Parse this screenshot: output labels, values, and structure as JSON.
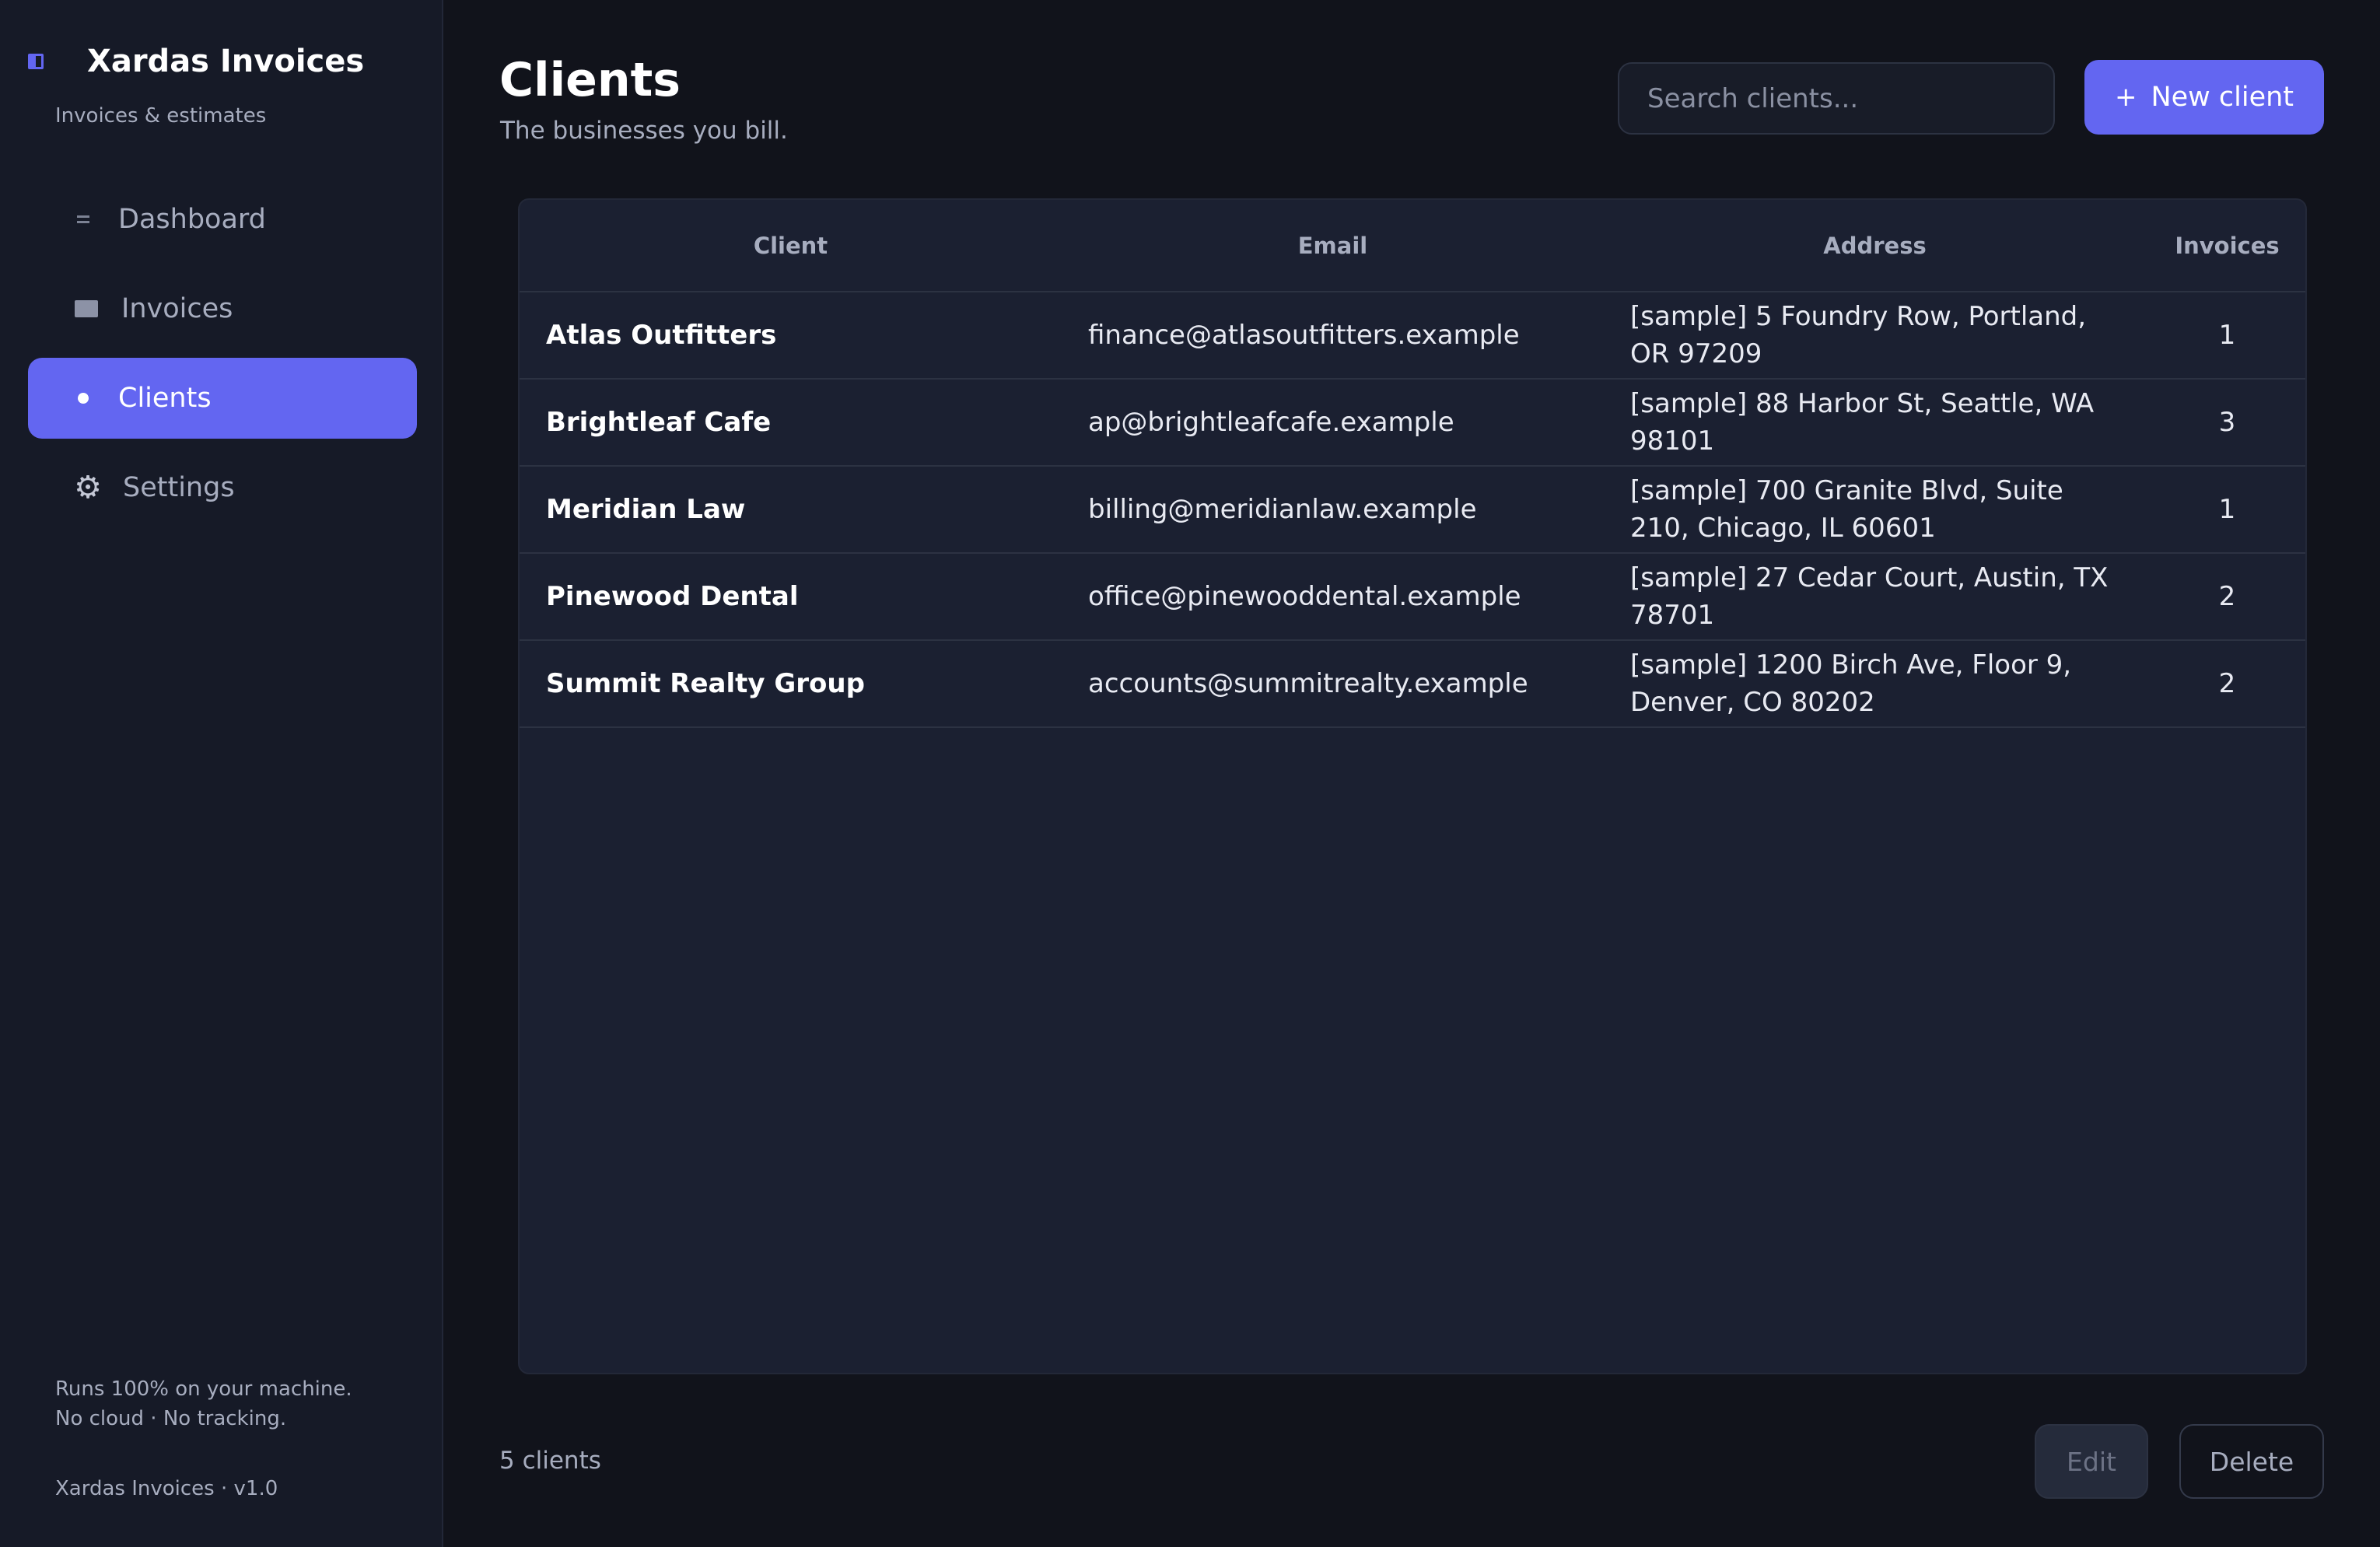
{
  "app": {
    "title": "Xardas Invoices",
    "subtitle": "Invoices & estimates",
    "brand_icon": "sidebar-panel-icon",
    "accent_color": "#6366f1"
  },
  "nav": [
    {
      "label": "Dashboard",
      "icon": "dashboard-icon",
      "active": false
    },
    {
      "label": "Invoices",
      "icon": "invoice-icon",
      "active": false
    },
    {
      "label": "Clients",
      "icon": "dot-icon",
      "active": true
    },
    {
      "label": "Settings",
      "icon": "gear-icon",
      "active": false
    }
  ],
  "sidebar_footer": {
    "line1": "Runs 100% on your machine.",
    "line2": "No cloud · No tracking.",
    "version": "Xardas Invoices · v1.0"
  },
  "page": {
    "title": "Clients",
    "subtitle": "The businesses you bill."
  },
  "search": {
    "placeholder": "Search clients...",
    "value": ""
  },
  "new_client_button": {
    "icon": "+",
    "label": "New client"
  },
  "table": {
    "columns": [
      "Client",
      "Email",
      "Address",
      "Invoices"
    ],
    "rows": [
      {
        "client": "Atlas Outfitters",
        "email": "finance@atlasoutfitters.example",
        "address": "[sample] 5 Foundry Row, Portland, OR 97209",
        "invoices": "1"
      },
      {
        "client": "Brightleaf Cafe",
        "email": "ap@brightleafcafe.example",
        "address": "[sample] 88 Harbor St, Seattle, WA 98101",
        "invoices": "3"
      },
      {
        "client": "Meridian Law",
        "email": "billing@meridianlaw.example",
        "address": "[sample] 700 Granite Blvd, Suite 210, Chicago, IL 60601",
        "invoices": "1"
      },
      {
        "client": "Pinewood Dental",
        "email": "office@pinewooddental.example",
        "address": "[sample] 27 Cedar Court, Austin, TX 78701",
        "invoices": "2"
      },
      {
        "client": "Summit Realty Group",
        "email": "accounts@summitrealty.example",
        "address": "[sample] 1200 Birch Ave, Floor 9, Denver, CO 80202",
        "invoices": "2"
      }
    ]
  },
  "footer": {
    "count": "5 clients",
    "edit_label": "Edit",
    "delete_label": "Delete"
  }
}
